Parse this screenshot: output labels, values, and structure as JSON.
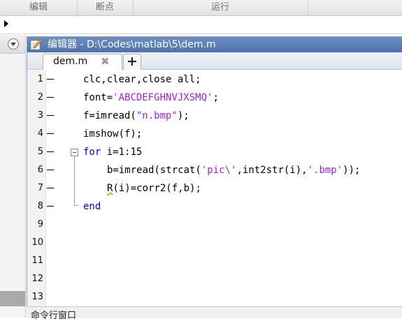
{
  "toolstrip": {
    "sections": [
      "编辑",
      "断点",
      "运行"
    ]
  },
  "editor": {
    "title": "编辑器 - D:\\Codes\\matlab\\5\\dem.m",
    "tab_label": "dem.m",
    "close_glyph": "✖",
    "add_tab_glyph": "+"
  },
  "code": {
    "lines": [
      {
        "n": "1",
        "dash": true
      },
      {
        "n": "2",
        "dash": true
      },
      {
        "n": "3",
        "dash": true
      },
      {
        "n": "4",
        "dash": true
      },
      {
        "n": "5",
        "dash": true
      },
      {
        "n": "6",
        "dash": true
      },
      {
        "n": "7",
        "dash": true
      },
      {
        "n": "8",
        "dash": true
      },
      {
        "n": "9",
        "dash": false
      },
      {
        "n": "10",
        "dash": false
      },
      {
        "n": "11",
        "dash": false
      },
      {
        "n": "12",
        "dash": false
      },
      {
        "n": "13",
        "dash": false
      }
    ],
    "text": {
      "l1": "clc,clear,close all;",
      "l2a": "font=",
      "l2b": "'ABCDEFGHNVJXSMQ'",
      "l2c": ";",
      "l3a": "f=imread(",
      "l3b": "\"n.bmp\"",
      "l3c": ");",
      "l4": "imshow(f);",
      "l5a": "for",
      "l5b": " i=1:15",
      "l6a": "b=imread(strcat(",
      "l6b": "'pic\\'",
      "l6c": ",int2str(i),",
      "l6d": "'.bmp'",
      "l6e": "));",
      "l7a": "R",
      "l7b": "(i)=corr2(f,b);",
      "l8": "end"
    }
  },
  "command_window": {
    "title": "命令行窗口"
  },
  "colors": {
    "keyword": "#0000ff",
    "string": "#a020f0",
    "title_bar": "#5a7db5"
  }
}
